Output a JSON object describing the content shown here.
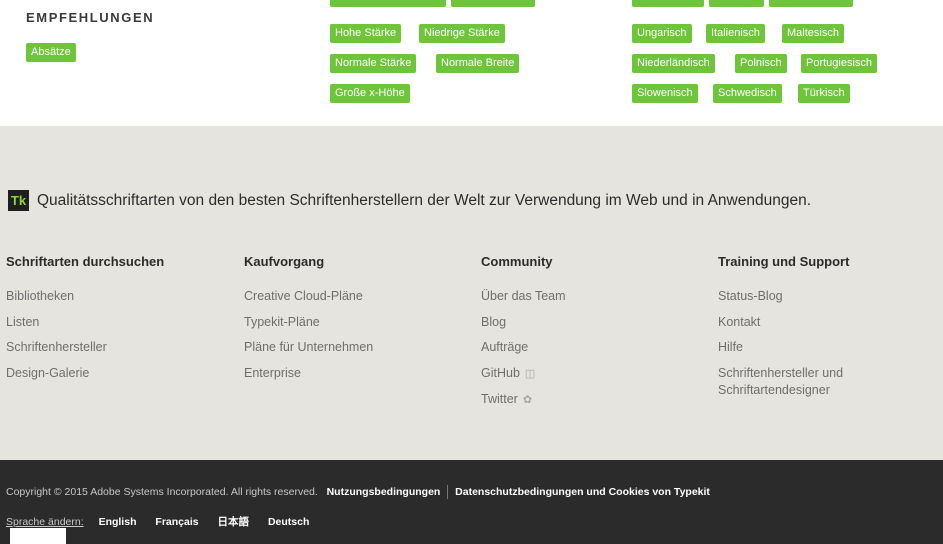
{
  "recommendations": {
    "title": "EMPFEHLUNGEN",
    "tags": [
      "Absätze"
    ]
  },
  "property_tags": [
    "Hohe Stärke",
    "Niedrige Stärke",
    "Normale Stärke",
    "Normale Breite",
    "Große x-Höhe"
  ],
  "language_tags": [
    "Ungarisch",
    "Italienisch",
    "Maltesisch",
    "Niederländisch",
    "Polnisch",
    "Portugiesisch",
    "Slowenisch",
    "Schwedisch",
    "Türkisch"
  ],
  "footer": {
    "logo": "Tk",
    "tagline": "Qualitätsschriftarten von den besten Schriftenherstellern der Welt zur Verwendung im Web und in Anwendungen.",
    "columns": [
      {
        "title": "Schriftarten durchsuchen",
        "links": [
          "Bibliotheken",
          "Listen",
          "Schriftenhersteller",
          "Design-Galerie"
        ]
      },
      {
        "title": "Kaufvorgang",
        "links": [
          "Creative Cloud-Pläne",
          "Typekit-Pläne",
          "Pläne für Unternehmen",
          "Enterprise"
        ]
      },
      {
        "title": "Community",
        "links": [
          "Über das Team",
          "Blog",
          "Aufträge",
          "GitHub",
          "Twitter"
        ]
      },
      {
        "title": "Training und Support",
        "links": [
          "Status-Blog",
          "Kontakt",
          "Hilfe",
          "Schriftenhersteller und Schriftartendesigner"
        ]
      }
    ]
  },
  "bottom": {
    "copyright": "Copyright © 2015 Adobe Systems Incorporated. All rights reserved.",
    "terms": "Nutzungsbedingungen",
    "privacy": "Datenschutzbedingungen und Cookies von Typekit",
    "change_language": "Sprache ändern:",
    "languages": [
      "English",
      "Français",
      "日本語",
      "Deutsch"
    ]
  },
  "colors": {
    "tag_green": "#6ec53a",
    "footer_bg": "#e6e4de",
    "bottom_bg": "#2b2b2b",
    "logo_bg": "#1f1f1f",
    "logo_fg": "#8fd53d"
  }
}
